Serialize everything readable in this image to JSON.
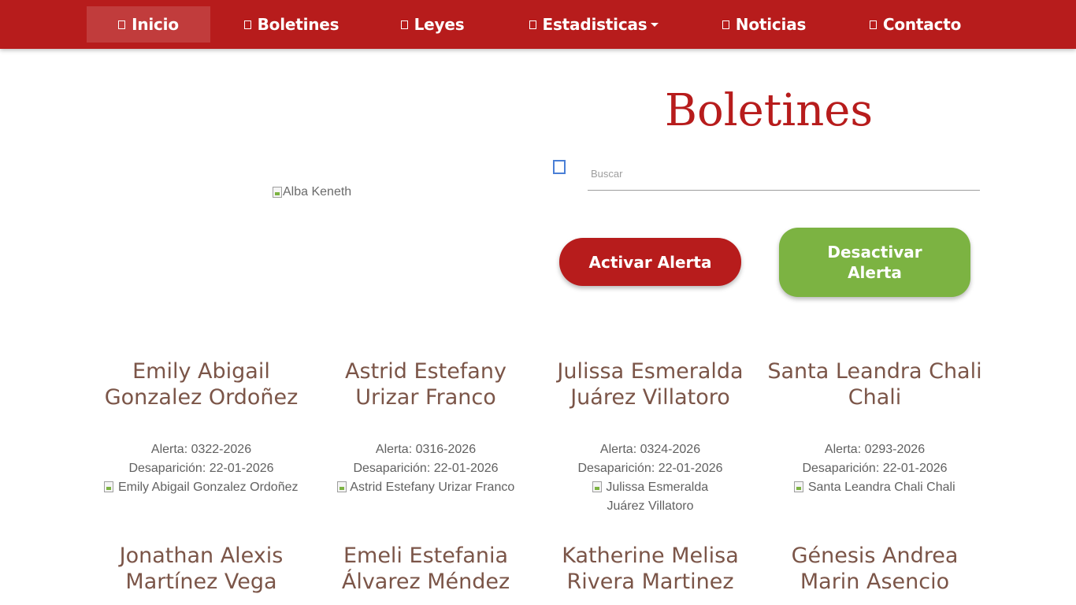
{
  "nav": {
    "items": [
      {
        "label": "Inicio"
      },
      {
        "label": "Boletines"
      },
      {
        "label": "Leyes"
      },
      {
        "label": "Estadisticas"
      },
      {
        "label": "Noticias"
      },
      {
        "label": "Contacto"
      }
    ]
  },
  "profile_image_alt": "Alba Keneth",
  "page_title": "Boletines",
  "search": {
    "placeholder": "Buscar"
  },
  "buttons": {
    "activate": "Activar Alerta",
    "deactivate": "Desactivar Alerta"
  },
  "cards": [
    {
      "name": "Emily Abigail Gonzalez Ordoñez",
      "alerta": "Alerta: 0322-2026",
      "desaparicion": "Desaparición: 22-01-2026",
      "photo_alt": "Emily Abigail Gonzalez Ordoñez"
    },
    {
      "name": "Astrid Estefany Urizar Franco",
      "alerta": "Alerta: 0316-2026",
      "desaparicion": "Desaparición: 22-01-2026",
      "photo_alt": "Astrid Estefany Urizar Franco"
    },
    {
      "name": "Julissa Esmeralda Juárez Villatoro",
      "alerta": "Alerta: 0324-2026",
      "desaparicion": "Desaparición: 22-01-2026",
      "photo_alt": "Julissa Esmeralda Juárez Villatoro"
    },
    {
      "name": "Santa Leandra Chali Chali",
      "alerta": "Alerta: 0293-2026",
      "desaparicion": "Desaparición: 22-01-2026",
      "photo_alt": "Santa Leandra Chali Chali"
    },
    {
      "name": "Jonathan Alexis Martínez Vega"
    },
    {
      "name": "Emeli Estefania Álvarez Méndez"
    },
    {
      "name": "Katherine Melisa Rivera Martinez"
    },
    {
      "name": "Génesis Andrea Marin Asencio"
    }
  ],
  "colors": {
    "primary_red": "#b71c1c",
    "green": "#7cb342",
    "name_brown": "#7b5548"
  },
  "icons": [
    "nav-square-icon",
    "caret-down-icon",
    "broken-image-icon"
  ]
}
